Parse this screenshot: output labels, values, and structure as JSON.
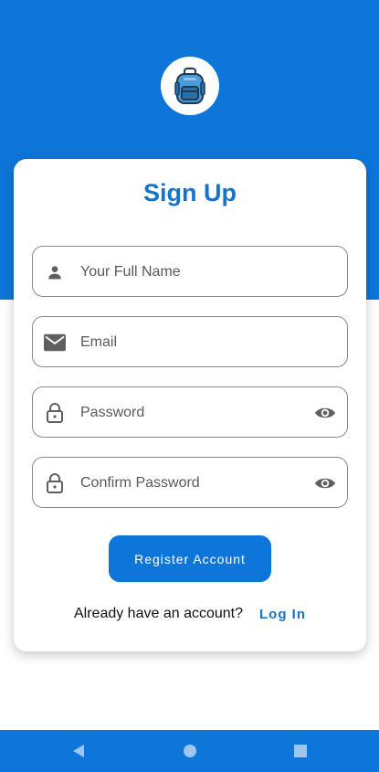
{
  "title": "Sign Up",
  "fields": [
    {
      "placeholder": "Your Full Name",
      "icon": "person-icon"
    },
    {
      "placeholder": "Email",
      "icon": "mail-icon"
    },
    {
      "placeholder": "Password",
      "icon": "lock-icon",
      "trailing_icon": "eye-icon"
    },
    {
      "placeholder": "Confirm Password",
      "icon": "lock-icon",
      "trailing_icon": "eye-icon"
    }
  ],
  "register_label": "Register Account",
  "footer": {
    "question": "Already have an account?",
    "link_label": "Log In"
  },
  "logo_icon": "backpack-icon",
  "colors": {
    "primary": "#0e76d9",
    "title": "#1474cc",
    "field_border": "#8a8a8a",
    "icon": "#5f5f5f"
  },
  "nav": {
    "back_icon": "back-triangle-icon",
    "home_icon": "home-circle-icon",
    "recents_icon": "recents-square-icon"
  }
}
